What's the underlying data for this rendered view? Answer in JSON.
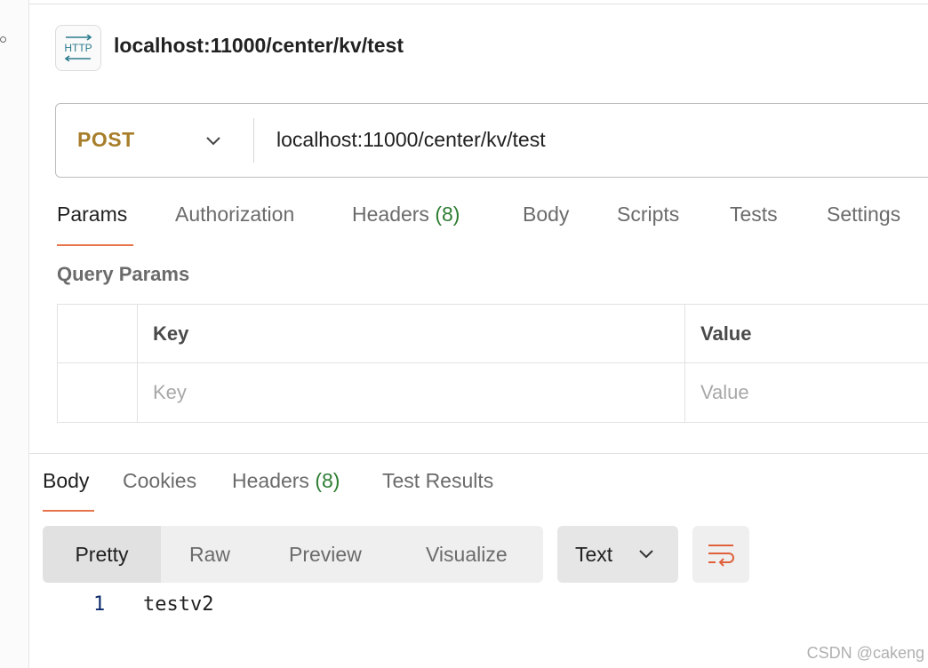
{
  "request": {
    "title": "localhost:11000/center/kv/test",
    "method": "POST",
    "url": "localhost:11000/center/kv/test"
  },
  "request_tabs": [
    {
      "label": "Params",
      "count": ""
    },
    {
      "label": "Authorization",
      "count": ""
    },
    {
      "label": "Headers",
      "count": "(8)"
    },
    {
      "label": "Body",
      "count": ""
    },
    {
      "label": "Scripts",
      "count": ""
    },
    {
      "label": "Tests",
      "count": ""
    },
    {
      "label": "Settings",
      "count": ""
    }
  ],
  "query_params": {
    "title": "Query Params",
    "headers": {
      "key": "Key",
      "value": "Value"
    },
    "placeholders": {
      "key": "Key",
      "value": "Value"
    }
  },
  "response_tabs": [
    {
      "label": "Body",
      "count": ""
    },
    {
      "label": "Cookies",
      "count": ""
    },
    {
      "label": "Headers",
      "count": "(8)"
    },
    {
      "label": "Test Results",
      "count": ""
    }
  ],
  "view_modes": [
    "Pretty",
    "Raw",
    "Preview",
    "Visualize"
  ],
  "format": "Text",
  "response_body": {
    "line_number": "1",
    "content": "testv2"
  },
  "watermark": "CSDN @cakeng",
  "colors": {
    "method_post": "#a77e2a",
    "accent_underline": "#e8744b",
    "count_green": "#2e7d32",
    "wrap_icon": "#e0603a",
    "http_icon": "#2a7b8c"
  },
  "icons": {
    "http": "http-icon",
    "method_dropdown": "chevron-down-icon",
    "format_dropdown": "chevron-down-icon",
    "wrap": "wrap-lines-icon"
  }
}
